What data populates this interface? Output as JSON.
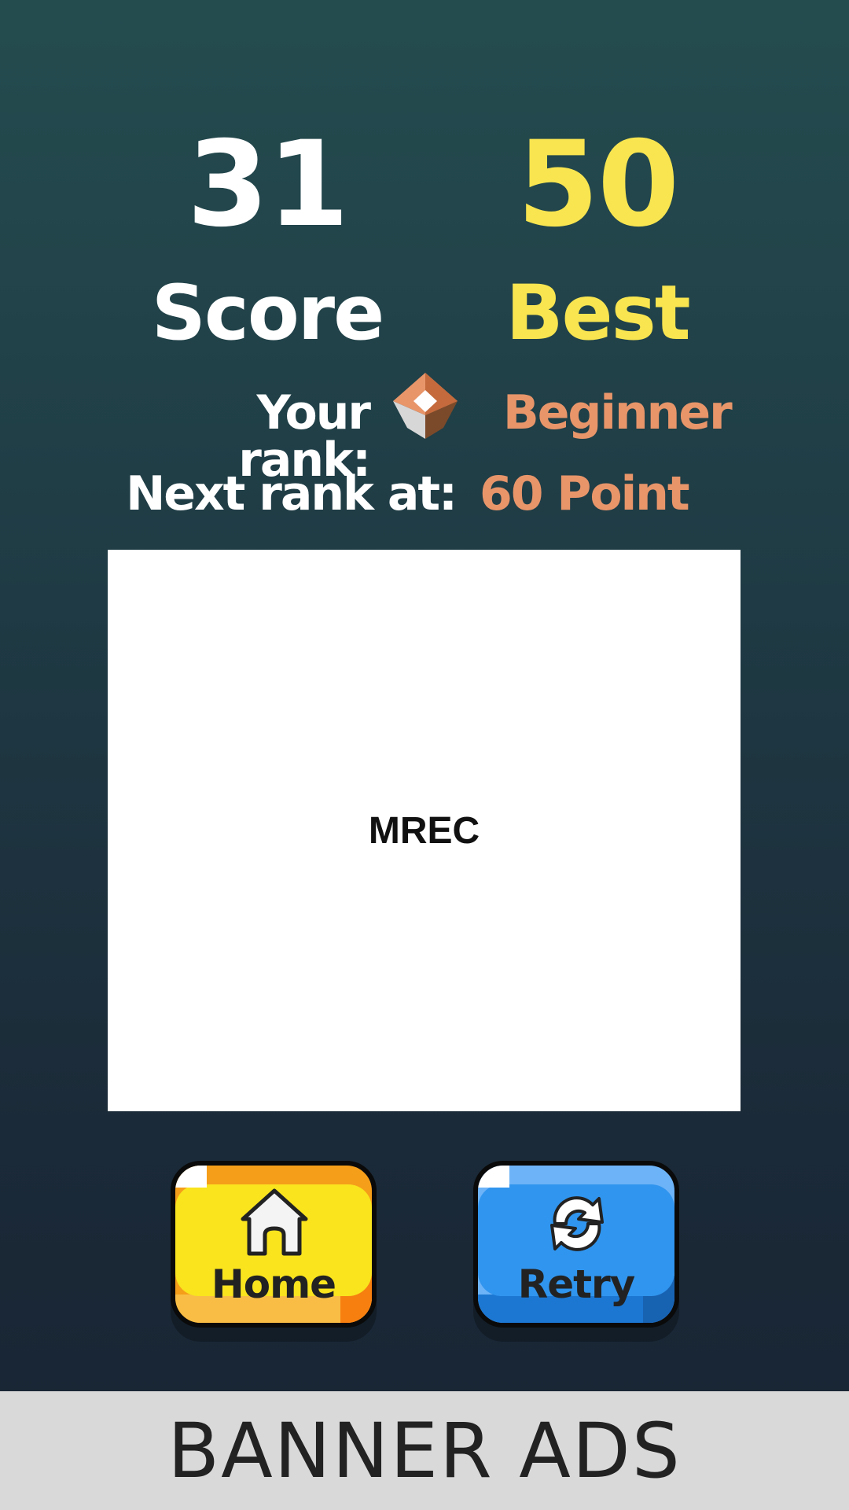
{
  "score": {
    "value": "31",
    "label": "Score"
  },
  "best": {
    "value": "50",
    "label": "Best"
  },
  "rank": {
    "label": "Your rank:",
    "value": "Beginner",
    "icon": "beginner-rank-gem-icon",
    "next_label": "Next rank at:",
    "next_value": "60 Point"
  },
  "ad": {
    "mrec_label": "MREC",
    "banner_label": "BANNER ADS"
  },
  "buttons": {
    "home_label": "Home",
    "home_icon": "home-icon",
    "retry_label": "Retry",
    "retry_icon": "refresh-icon"
  },
  "colors": {
    "score": "#ffffff",
    "best": "#f8e550",
    "rank_accent": "#e8956a",
    "home_button": "#f9e41e",
    "retry_button": "#3095ee"
  }
}
